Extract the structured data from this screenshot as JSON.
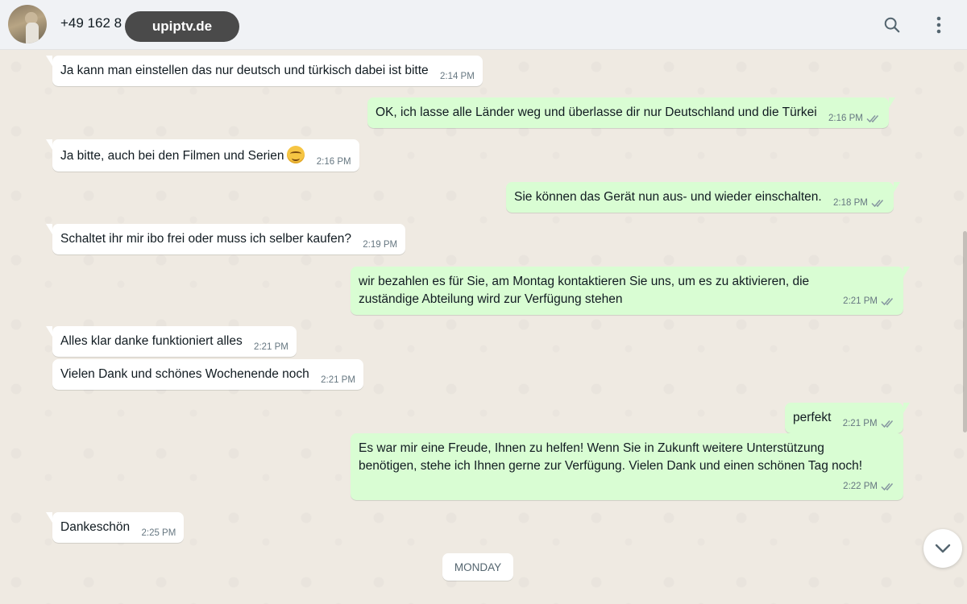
{
  "header": {
    "contact_name": "+49 162 8",
    "watermark": "upiptv.de"
  },
  "messages": [
    {
      "dir": "in",
      "text": "Ja kann man einstellen das nur deutsch und türkisch dabei ist bitte",
      "time": "2:14 PM"
    },
    {
      "dir": "out",
      "text": "OK, ich lasse alle Länder weg und überlasse dir nur Deutschland und die Türkei",
      "time": "2:16 PM",
      "status": "read"
    },
    {
      "dir": "in",
      "text": "Ja bitte, auch bei den Filmen und Serien",
      "emoji": "smiling-face",
      "time": "2:16 PM"
    },
    {
      "dir": "out",
      "text": "Sie können das Gerät nun aus- und wieder einschalten.",
      "time": "2:18 PM",
      "status": "read"
    },
    {
      "dir": "in",
      "text": "Schaltet ihr mir ibo frei oder muss ich selber kaufen?",
      "time": "2:19 PM"
    },
    {
      "dir": "out",
      "line1": "wir bezahlen es für Sie, am Montag kontaktieren Sie uns, um es zu aktivieren, die",
      "line2": "zuständige Abteilung wird zur Verfügung stehen",
      "time": "2:21 PM",
      "status": "read"
    },
    {
      "dir": "in",
      "text": "Alles klar danke funktioniert alles",
      "time": "2:21 PM"
    },
    {
      "dir": "in",
      "text": "Vielen Dank und schönes Wochenende noch",
      "time": "2:21 PM"
    },
    {
      "dir": "out",
      "text": "perfekt",
      "time": "2:21 PM",
      "status": "read"
    },
    {
      "dir": "out",
      "line1": "Es war mir eine Freude, Ihnen zu helfen! Wenn Sie in Zukunft weitere Unterstützung",
      "line2": "benötigen, stehe ich Ihnen gerne zur Verfügung. Vielen Dank und einen schönen Tag noch!",
      "time": "2:22 PM",
      "status": "read"
    },
    {
      "dir": "in",
      "text": "Dankeschön",
      "time": "2:25 PM"
    }
  ],
  "day_divider": "MONDAY",
  "colors": {
    "incoming_bubble": "#ffffff",
    "outgoing_bubble": "#d9fdd3",
    "chat_background": "#efeae2",
    "read_ticks": "#8696a0"
  },
  "icons": {
    "search": "search-icon",
    "menu": "kebab-menu-icon",
    "scroll_down": "chevron-down-icon",
    "read_status": "double-check-icon"
  }
}
